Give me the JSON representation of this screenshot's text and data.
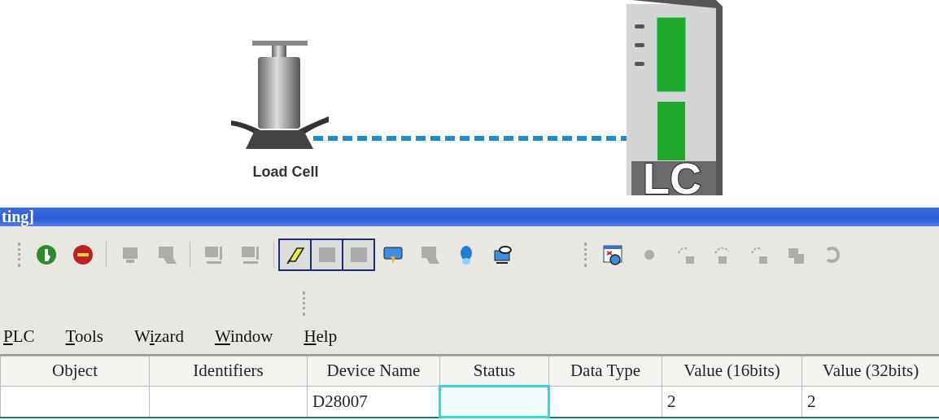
{
  "diagram": {
    "sensor_label": "Load Cell",
    "module_label": "LC"
  },
  "window": {
    "title": "ting]"
  },
  "toolbar": {
    "groups": [
      [
        {
          "kind": "start",
          "disabled": false,
          "pressed": false
        },
        {
          "kind": "stop",
          "disabled": false,
          "pressed": false
        },
        {
          "kind": "sep"
        },
        {
          "kind": "pc",
          "disabled": true,
          "pressed": false
        },
        {
          "kind": "pc-arrow",
          "disabled": true,
          "pressed": false
        },
        {
          "kind": "sep"
        },
        {
          "kind": "pc-io",
          "disabled": true,
          "pressed": false
        },
        {
          "kind": "pc-io",
          "disabled": true,
          "pressed": false
        },
        {
          "kind": "sep"
        },
        {
          "kind": "pen",
          "disabled": false,
          "pressed": true
        },
        {
          "kind": "screen",
          "disabled": true,
          "pressed": true
        },
        {
          "kind": "screen",
          "disabled": true,
          "pressed": true
        },
        {
          "kind": "monitor-down",
          "disabled": false,
          "pressed": false
        },
        {
          "kind": "pc-arrow",
          "disabled": true,
          "pressed": false
        },
        {
          "kind": "bulb",
          "disabled": false,
          "pressed": false
        },
        {
          "kind": "pc-eye",
          "disabled": false,
          "pressed": false
        }
      ],
      [
        {
          "kind": "watch",
          "disabled": false,
          "pressed": false
        },
        {
          "kind": "dot",
          "disabled": true,
          "pressed": false
        },
        {
          "kind": "upload",
          "disabled": true,
          "pressed": false
        },
        {
          "kind": "download",
          "disabled": true,
          "pressed": false
        },
        {
          "kind": "upload",
          "disabled": true,
          "pressed": false
        },
        {
          "kind": "copy",
          "disabled": true,
          "pressed": false
        },
        {
          "kind": "refresh",
          "disabled": true,
          "pressed": false
        }
      ]
    ]
  },
  "menu": [
    {
      "key": "P",
      "after": "LC"
    },
    {
      "key": "T",
      "after": "ools"
    },
    {
      "before": "W",
      "key": "i",
      "after": "zard"
    },
    {
      "key": "W",
      "after": "indow"
    },
    {
      "key": "H",
      "after": "elp"
    }
  ],
  "table": {
    "columns": [
      "Object",
      "Identifiers",
      "Device Name",
      "Status",
      "Data Type",
      "Value (16bits)",
      "Value (32bits)"
    ],
    "rows": [
      {
        "cells": [
          {
            "focused": false
          },
          {
            "focused": false
          },
          {
            "text": "D28007",
            "focused": false
          },
          {
            "focused": true
          },
          {
            "focused": false
          },
          {
            "text": "2",
            "focused": false
          },
          {
            "text": "2",
            "focused": false
          }
        ]
      }
    ]
  }
}
